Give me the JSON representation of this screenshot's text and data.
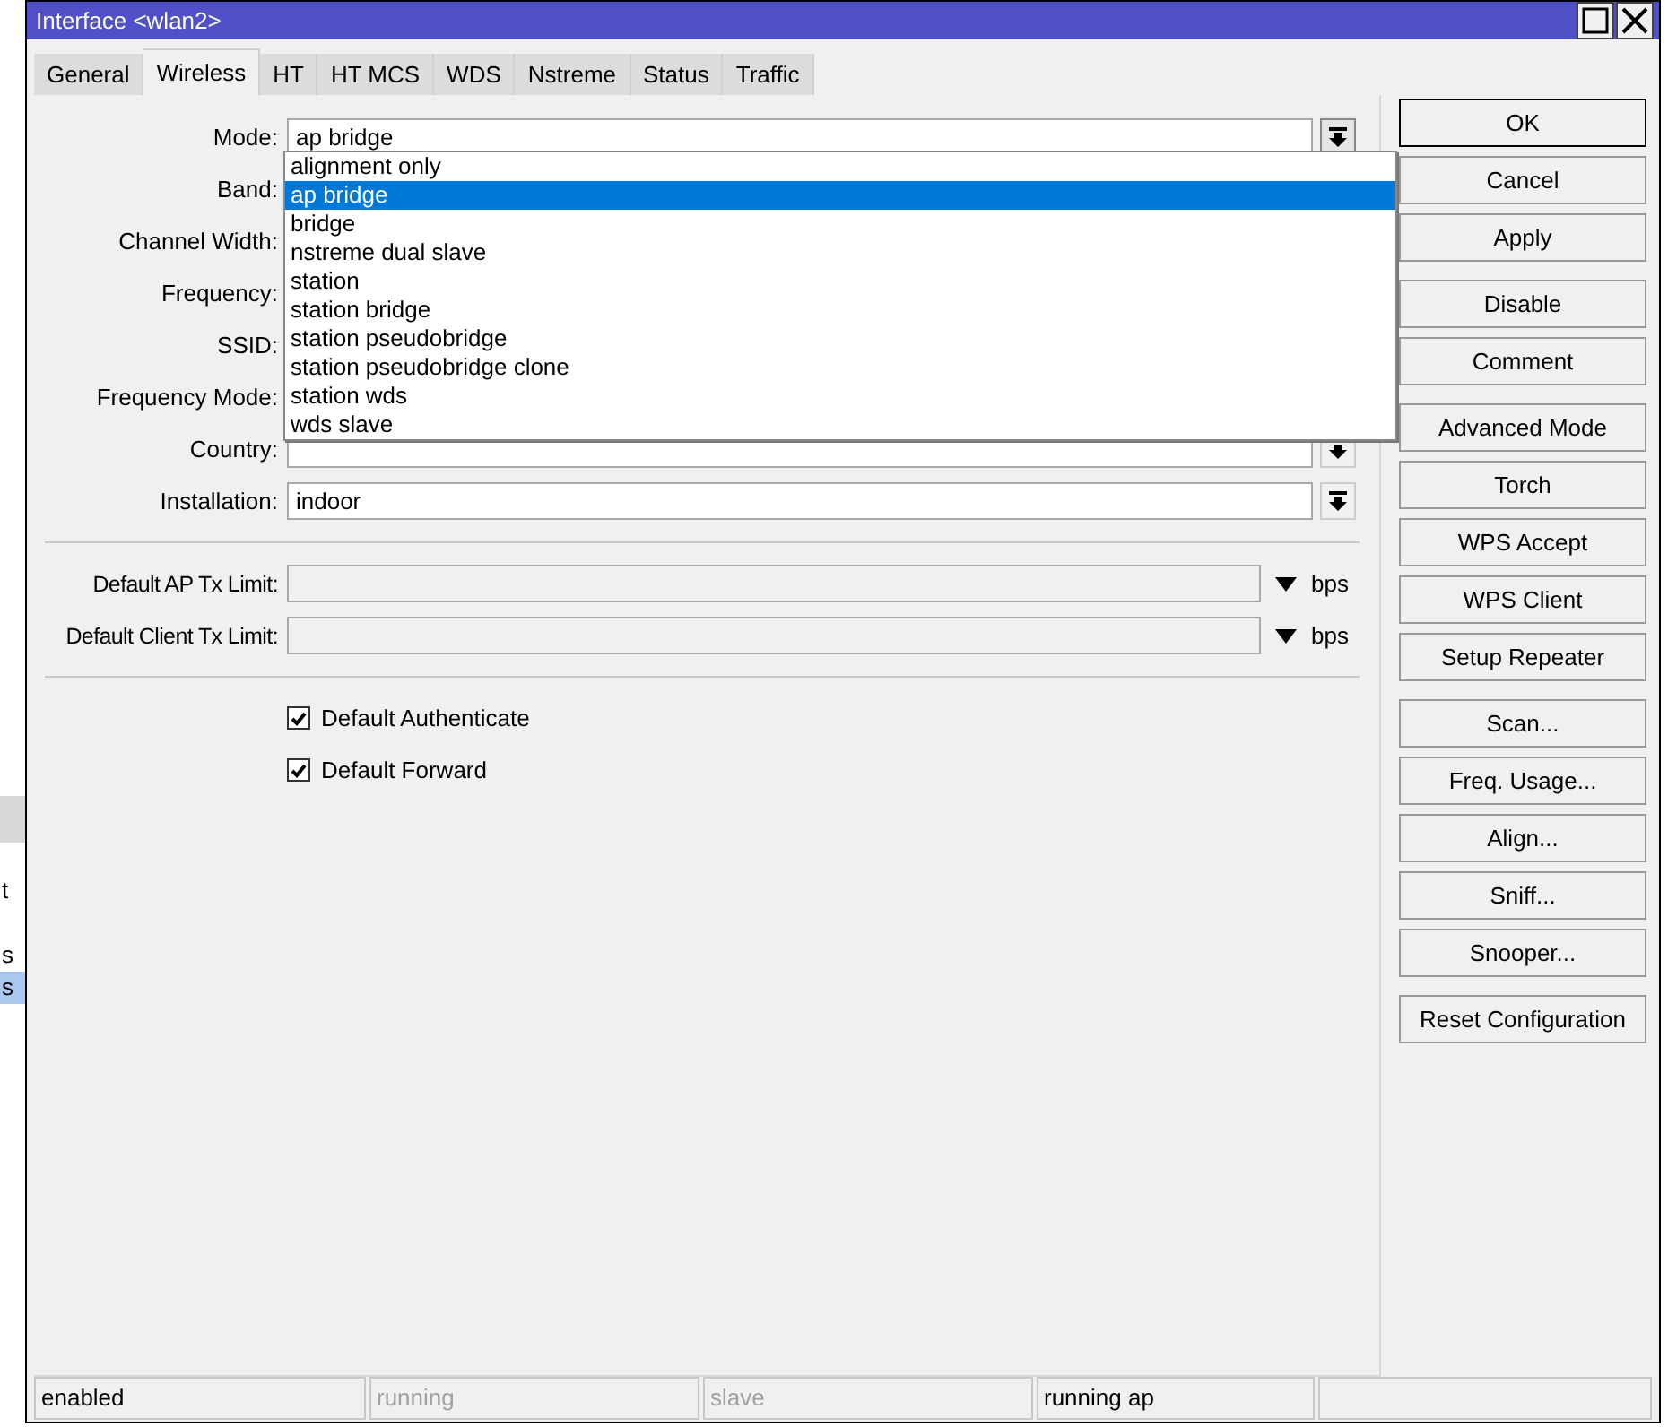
{
  "background_window": {
    "texts": [
      {
        "text": "t",
        "selected": false
      },
      {
        "text": "s",
        "selected": false
      },
      {
        "text": "s",
        "selected": true
      }
    ]
  },
  "window": {
    "title": "Interface <wlan2>"
  },
  "tabs": [
    {
      "label": "General",
      "selected": false
    },
    {
      "label": "Wireless",
      "selected": true
    },
    {
      "label": "HT",
      "selected": false
    },
    {
      "label": "HT MCS",
      "selected": false
    },
    {
      "label": "WDS",
      "selected": false
    },
    {
      "label": "Nstreme",
      "selected": false
    },
    {
      "label": "Status",
      "selected": false
    },
    {
      "label": "Traffic",
      "selected": false
    }
  ],
  "fields": [
    {
      "label": "Mode:",
      "value": "ap bridge",
      "expanded": true
    },
    {
      "label": "Band:"
    },
    {
      "label": "Channel Width:"
    },
    {
      "label": "Frequency:"
    },
    {
      "label": "SSID:"
    },
    {
      "label": "Frequency Mode:"
    },
    {
      "label": "Country:"
    },
    {
      "label": "Installation:",
      "value": "indoor"
    }
  ],
  "dropdown_options": [
    {
      "label": "alignment only",
      "selected": false
    },
    {
      "label": "ap bridge",
      "selected": true
    },
    {
      "label": "bridge",
      "selected": false
    },
    {
      "label": "nstreme dual slave",
      "selected": false
    },
    {
      "label": "station",
      "selected": false
    },
    {
      "label": "station bridge",
      "selected": false
    },
    {
      "label": "station pseudobridge",
      "selected": false
    },
    {
      "label": "station pseudobridge clone",
      "selected": false
    },
    {
      "label": "station wds",
      "selected": false
    },
    {
      "label": "wds slave",
      "selected": false
    }
  ],
  "limits": [
    {
      "label": "Default AP Tx Limit:",
      "unit": "bps"
    },
    {
      "label": "Default Client Tx Limit:",
      "unit": "bps"
    }
  ],
  "checkboxes": [
    {
      "label": "Default Authenticate",
      "checked": true
    },
    {
      "label": "Default Forward",
      "checked": true
    }
  ],
  "button_groups": [
    [
      {
        "label": "OK",
        "default": true
      },
      {
        "label": "Cancel",
        "default": false
      },
      {
        "label": "Apply",
        "default": false
      }
    ],
    [
      {
        "label": "Disable",
        "default": false
      },
      {
        "label": "Comment",
        "default": false
      }
    ],
    [
      {
        "label": "Advanced Mode",
        "default": false
      },
      {
        "label": "Torch",
        "default": false
      },
      {
        "label": "WPS Accept",
        "default": false
      },
      {
        "label": "WPS Client",
        "default": false
      },
      {
        "label": "Setup Repeater",
        "default": false
      }
    ],
    [
      {
        "label": "Scan...",
        "default": false
      },
      {
        "label": "Freq. Usage...",
        "default": false
      },
      {
        "label": "Align...",
        "default": false
      },
      {
        "label": "Sniff...",
        "default": false
      },
      {
        "label": "Snooper...",
        "default": false
      }
    ],
    [
      {
        "label": "Reset Configuration",
        "default": false
      }
    ]
  ],
  "status_bar": [
    {
      "text": "enabled",
      "active": true
    },
    {
      "text": "running",
      "active": false
    },
    {
      "text": "slave",
      "active": false
    },
    {
      "text": "running ap",
      "active": true
    }
  ]
}
